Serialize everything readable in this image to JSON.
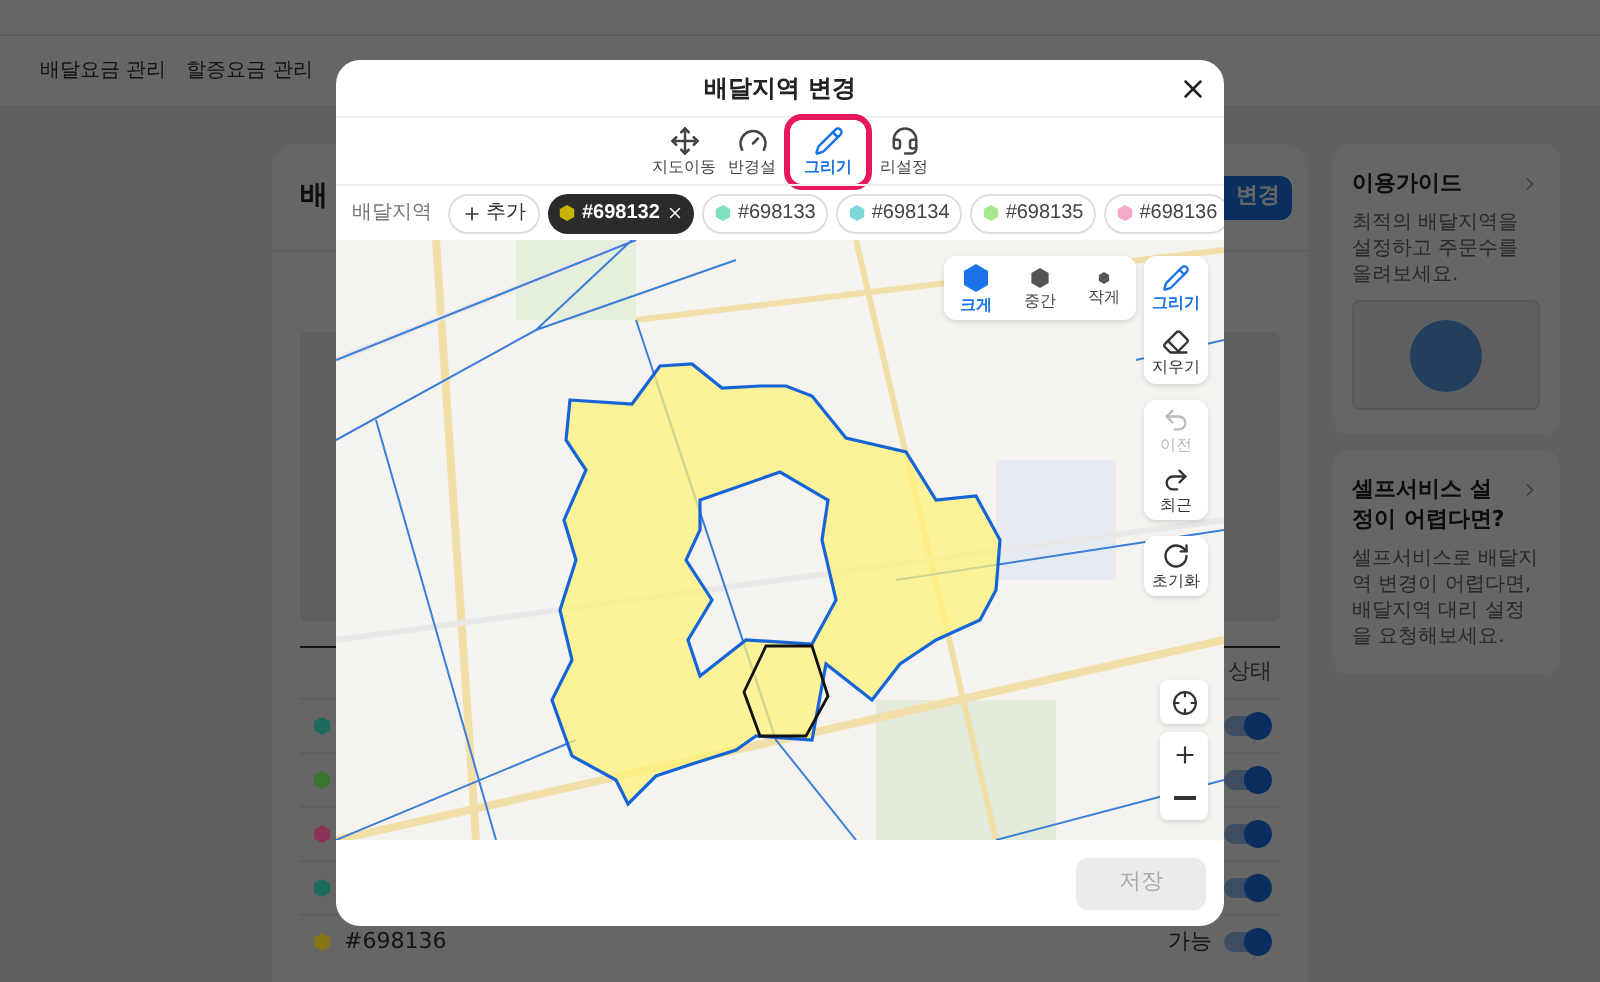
{
  "background_page": {
    "nav": [
      {
        "label": "배달요금 관리"
      },
      {
        "label": "할증요금 관리"
      }
    ],
    "main_card": {
      "title": "배",
      "button": "변경",
      "status_header": "상태",
      "rows": [
        {
          "color": "#1d6b5e",
          "on": true
        },
        {
          "color": "#3a7530",
          "on": true
        },
        {
          "color": "#8a3257",
          "on": true
        },
        {
          "color": "#1d6b5e",
          "on": true
        },
        {
          "color": "#857515",
          "label": "#698136",
          "status": "가능",
          "on": true
        }
      ]
    },
    "guide_cards": [
      {
        "title": "이용가이드",
        "text": "최적의 배달지역을 설정하고 주문수를 올려보세요.",
        "illustration": true
      },
      {
        "title": "셀프서비스 설정이 어렵다면?",
        "text": "셀프서비스로 배달지역 변경이 어렵다면, 배달지역 대리 설정을 요청해보세요.",
        "illustration": false
      }
    ]
  },
  "dialog": {
    "title": "배달지역 변경",
    "tools": [
      {
        "kind": "move",
        "label": "지도이동",
        "selected": false
      },
      {
        "kind": "radius",
        "label": "반경설",
        "selected": false
      },
      {
        "kind": "draw",
        "label": "그리기",
        "selected": true
      },
      {
        "kind": "distance",
        "label": "리설정",
        "selected": false
      }
    ],
    "area_label": "배달지역",
    "add_button": "추가",
    "areas": [
      {
        "label": "#698132",
        "color": "#c8b400",
        "selected": true
      },
      {
        "label": "#698133",
        "color": "#7ee0c0",
        "selected": false
      },
      {
        "label": "#698134",
        "color": "#7fd8d8",
        "selected": false
      },
      {
        "label": "#698135",
        "color": "#a8e890",
        "selected": false
      },
      {
        "label": "#698136",
        "color": "#f5a8c8",
        "selected": false
      }
    ],
    "map": {
      "sizes": [
        {
          "kind": "large",
          "label": "크게",
          "selected": true
        },
        {
          "kind": "medium",
          "label": "중간",
          "selected": false
        },
        {
          "kind": "small",
          "label": "작게",
          "selected": false
        }
      ],
      "tools": [
        {
          "kind": "draw",
          "label": "그리기",
          "selected": true
        },
        {
          "kind": "erase",
          "label": "지우기",
          "selected": false
        }
      ],
      "history": [
        {
          "kind": "undo",
          "label": "이전",
          "disabled": true
        },
        {
          "kind": "redo",
          "label": "최근",
          "disabled": false
        }
      ],
      "reset": {
        "label": "초기화"
      }
    },
    "save_button": {
      "label": "저장",
      "disabled": true
    }
  }
}
